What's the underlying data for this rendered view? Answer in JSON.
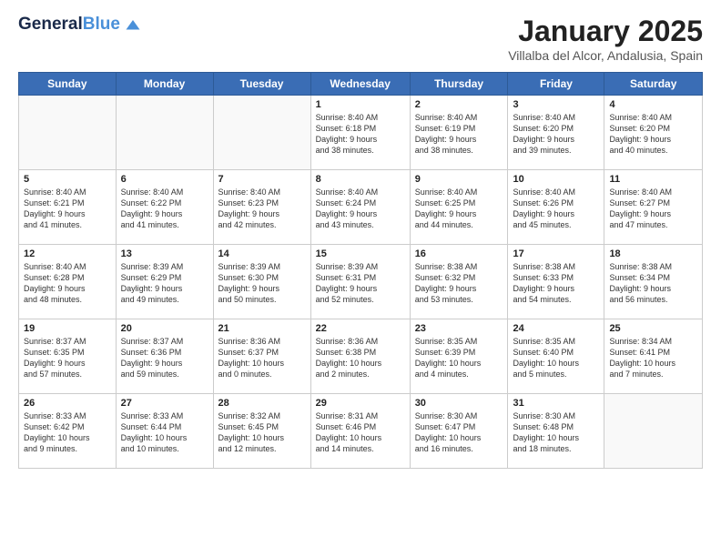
{
  "header": {
    "logo_general": "General",
    "logo_blue": "Blue",
    "month_title": "January 2025",
    "location": "Villalba del Alcor, Andalusia, Spain"
  },
  "days_of_week": [
    "Sunday",
    "Monday",
    "Tuesday",
    "Wednesday",
    "Thursday",
    "Friday",
    "Saturday"
  ],
  "weeks": [
    [
      {
        "day": "",
        "text": ""
      },
      {
        "day": "",
        "text": ""
      },
      {
        "day": "",
        "text": ""
      },
      {
        "day": "1",
        "text": "Sunrise: 8:40 AM\nSunset: 6:18 PM\nDaylight: 9 hours\nand 38 minutes."
      },
      {
        "day": "2",
        "text": "Sunrise: 8:40 AM\nSunset: 6:19 PM\nDaylight: 9 hours\nand 38 minutes."
      },
      {
        "day": "3",
        "text": "Sunrise: 8:40 AM\nSunset: 6:20 PM\nDaylight: 9 hours\nand 39 minutes."
      },
      {
        "day": "4",
        "text": "Sunrise: 8:40 AM\nSunset: 6:20 PM\nDaylight: 9 hours\nand 40 minutes."
      }
    ],
    [
      {
        "day": "5",
        "text": "Sunrise: 8:40 AM\nSunset: 6:21 PM\nDaylight: 9 hours\nand 41 minutes."
      },
      {
        "day": "6",
        "text": "Sunrise: 8:40 AM\nSunset: 6:22 PM\nDaylight: 9 hours\nand 41 minutes."
      },
      {
        "day": "7",
        "text": "Sunrise: 8:40 AM\nSunset: 6:23 PM\nDaylight: 9 hours\nand 42 minutes."
      },
      {
        "day": "8",
        "text": "Sunrise: 8:40 AM\nSunset: 6:24 PM\nDaylight: 9 hours\nand 43 minutes."
      },
      {
        "day": "9",
        "text": "Sunrise: 8:40 AM\nSunset: 6:25 PM\nDaylight: 9 hours\nand 44 minutes."
      },
      {
        "day": "10",
        "text": "Sunrise: 8:40 AM\nSunset: 6:26 PM\nDaylight: 9 hours\nand 45 minutes."
      },
      {
        "day": "11",
        "text": "Sunrise: 8:40 AM\nSunset: 6:27 PM\nDaylight: 9 hours\nand 47 minutes."
      }
    ],
    [
      {
        "day": "12",
        "text": "Sunrise: 8:40 AM\nSunset: 6:28 PM\nDaylight: 9 hours\nand 48 minutes."
      },
      {
        "day": "13",
        "text": "Sunrise: 8:39 AM\nSunset: 6:29 PM\nDaylight: 9 hours\nand 49 minutes."
      },
      {
        "day": "14",
        "text": "Sunrise: 8:39 AM\nSunset: 6:30 PM\nDaylight: 9 hours\nand 50 minutes."
      },
      {
        "day": "15",
        "text": "Sunrise: 8:39 AM\nSunset: 6:31 PM\nDaylight: 9 hours\nand 52 minutes."
      },
      {
        "day": "16",
        "text": "Sunrise: 8:38 AM\nSunset: 6:32 PM\nDaylight: 9 hours\nand 53 minutes."
      },
      {
        "day": "17",
        "text": "Sunrise: 8:38 AM\nSunset: 6:33 PM\nDaylight: 9 hours\nand 54 minutes."
      },
      {
        "day": "18",
        "text": "Sunrise: 8:38 AM\nSunset: 6:34 PM\nDaylight: 9 hours\nand 56 minutes."
      }
    ],
    [
      {
        "day": "19",
        "text": "Sunrise: 8:37 AM\nSunset: 6:35 PM\nDaylight: 9 hours\nand 57 minutes."
      },
      {
        "day": "20",
        "text": "Sunrise: 8:37 AM\nSunset: 6:36 PM\nDaylight: 9 hours\nand 59 minutes."
      },
      {
        "day": "21",
        "text": "Sunrise: 8:36 AM\nSunset: 6:37 PM\nDaylight: 10 hours\nand 0 minutes."
      },
      {
        "day": "22",
        "text": "Sunrise: 8:36 AM\nSunset: 6:38 PM\nDaylight: 10 hours\nand 2 minutes."
      },
      {
        "day": "23",
        "text": "Sunrise: 8:35 AM\nSunset: 6:39 PM\nDaylight: 10 hours\nand 4 minutes."
      },
      {
        "day": "24",
        "text": "Sunrise: 8:35 AM\nSunset: 6:40 PM\nDaylight: 10 hours\nand 5 minutes."
      },
      {
        "day": "25",
        "text": "Sunrise: 8:34 AM\nSunset: 6:41 PM\nDaylight: 10 hours\nand 7 minutes."
      }
    ],
    [
      {
        "day": "26",
        "text": "Sunrise: 8:33 AM\nSunset: 6:42 PM\nDaylight: 10 hours\nand 9 minutes."
      },
      {
        "day": "27",
        "text": "Sunrise: 8:33 AM\nSunset: 6:44 PM\nDaylight: 10 hours\nand 10 minutes."
      },
      {
        "day": "28",
        "text": "Sunrise: 8:32 AM\nSunset: 6:45 PM\nDaylight: 10 hours\nand 12 minutes."
      },
      {
        "day": "29",
        "text": "Sunrise: 8:31 AM\nSunset: 6:46 PM\nDaylight: 10 hours\nand 14 minutes."
      },
      {
        "day": "30",
        "text": "Sunrise: 8:30 AM\nSunset: 6:47 PM\nDaylight: 10 hours\nand 16 minutes."
      },
      {
        "day": "31",
        "text": "Sunrise: 8:30 AM\nSunset: 6:48 PM\nDaylight: 10 hours\nand 18 minutes."
      },
      {
        "day": "",
        "text": ""
      }
    ]
  ]
}
